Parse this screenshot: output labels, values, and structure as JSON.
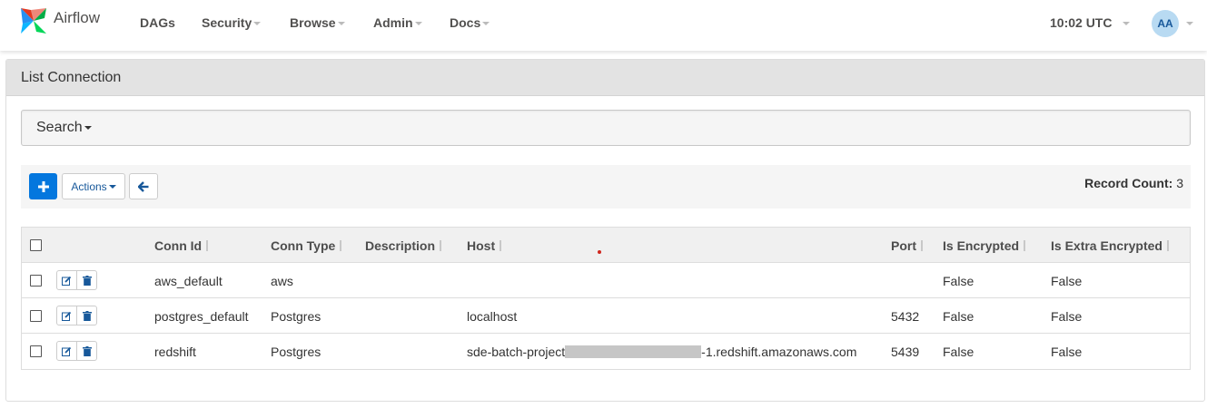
{
  "navbar": {
    "brand": "Airflow",
    "items": [
      {
        "label": "DAGs",
        "dropdown": false
      },
      {
        "label": "Security",
        "dropdown": true
      },
      {
        "label": "Browse",
        "dropdown": true
      },
      {
        "label": "Admin",
        "dropdown": true
      },
      {
        "label": "Docs",
        "dropdown": true
      }
    ],
    "time": "10:02 UTC",
    "user_initials": "AA"
  },
  "panel": {
    "title": "List Connection",
    "search_label": "Search",
    "actions_label": "Actions",
    "record_count_label": "Record Count:",
    "record_count": "3"
  },
  "table": {
    "columns": [
      "Conn Id",
      "Conn Type",
      "Description",
      "Host",
      "Port",
      "Is Encrypted",
      "Is Extra Encrypted"
    ],
    "rows": [
      {
        "conn_id": "aws_default",
        "conn_type": "aws",
        "description": "",
        "host": "",
        "host_suffix": "",
        "port": "",
        "is_encrypted": "False",
        "is_extra_encrypted": "False"
      },
      {
        "conn_id": "postgres_default",
        "conn_type": "Postgres",
        "description": "",
        "host": "localhost",
        "host_suffix": "",
        "port": "5432",
        "is_encrypted": "False",
        "is_extra_encrypted": "False"
      },
      {
        "conn_id": "redshift",
        "conn_type": "Postgres",
        "description": "",
        "host": "sde-batch-project",
        "host_suffix": "-1.redshift.amazonaws.com",
        "port": "5439",
        "is_encrypted": "False",
        "is_extra_encrypted": "False"
      }
    ]
  },
  "colors": {
    "primary": "#0477de",
    "link": "#17589a",
    "header_bg": "#e3e3e3"
  },
  "icons": {
    "logo": "airflow-pinwheel-icon",
    "add": "plus-icon",
    "back": "arrow-left-icon",
    "edit": "edit-icon",
    "delete": "trash-icon"
  }
}
